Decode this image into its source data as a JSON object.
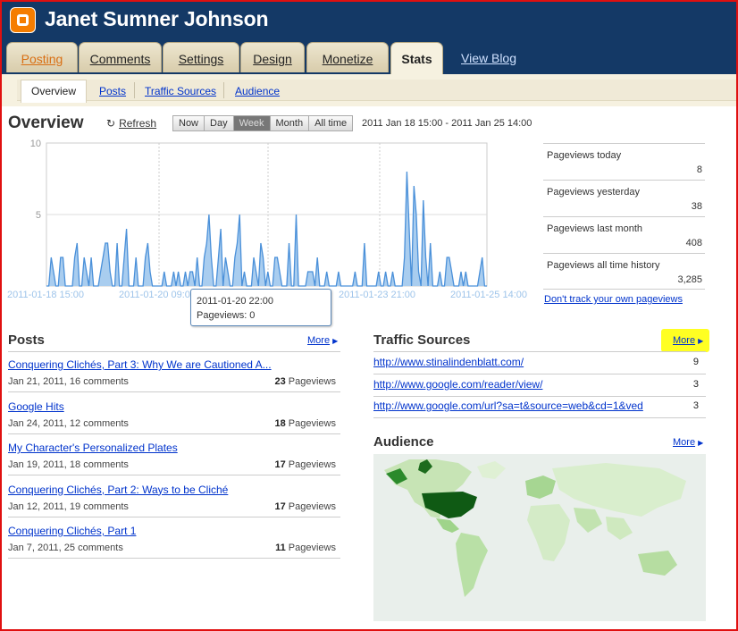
{
  "header": {
    "title": "Janet Sumner Johnson"
  },
  "tabs": [
    "Posting",
    "Comments",
    "Settings",
    "Design",
    "Monetize",
    "Stats"
  ],
  "view_blog": "View Blog",
  "subtabs": [
    "Overview",
    "Posts",
    "Traffic Sources",
    "Audience"
  ],
  "overview": {
    "title": "Overview",
    "refresh": "Refresh",
    "ranges": [
      "Now",
      "Day",
      "Week",
      "Month",
      "All time"
    ],
    "selected_range": "Week",
    "date_range": "2011 Jan 18 15:00 - 2011 Jan 25 14:00"
  },
  "chart_data": {
    "type": "area",
    "ylim": [
      0,
      10
    ],
    "yticks": [
      "10",
      "5"
    ],
    "xtick_labels": [
      "2011-01-18 15:00",
      "2011-01-20 09:00",
      "2011-01-23 21:00",
      "2011-01-25 14:00"
    ],
    "values": [
      0,
      0,
      2,
      1,
      0,
      0,
      2,
      2,
      0,
      0,
      0,
      0,
      2,
      3,
      0,
      0,
      2,
      1,
      0,
      2,
      0,
      0,
      0,
      1,
      2,
      3,
      3,
      1,
      0,
      0,
      3,
      0,
      0,
      2,
      4,
      0,
      0,
      0,
      2,
      0,
      0,
      0,
      2,
      3,
      1,
      0,
      0,
      0,
      0,
      0,
      1,
      0,
      0,
      0,
      1,
      0,
      1,
      0,
      0,
      1,
      0,
      1,
      1,
      0,
      2,
      0,
      0,
      2,
      3,
      5,
      2,
      0,
      0,
      2,
      4,
      0,
      2,
      1,
      0,
      0,
      2,
      3,
      5,
      0,
      1,
      0,
      0,
      0,
      2,
      1,
      0,
      3,
      2,
      0,
      1,
      0,
      0,
      2,
      2,
      1,
      0,
      0,
      0,
      3,
      0,
      0,
      5,
      0,
      0,
      0,
      0,
      1,
      1,
      1,
      0,
      2,
      0,
      0,
      0,
      1,
      0,
      0,
      0,
      0,
      1,
      0,
      0,
      0,
      0,
      0,
      0,
      1,
      0,
      0,
      0,
      3,
      0,
      0,
      0,
      0,
      0,
      1,
      0,
      0,
      1,
      0,
      0,
      1,
      0,
      0,
      0,
      0,
      2,
      8,
      4,
      0,
      7,
      5,
      1,
      0,
      6,
      2,
      0,
      3,
      0,
      0,
      0,
      1,
      0,
      0,
      2,
      2,
      1,
      0,
      0,
      0,
      1,
      0,
      1,
      0,
      0,
      0,
      0,
      0,
      1,
      2,
      0,
      0
    ],
    "tooltip": {
      "label": "2011-01-20 22:00",
      "value": "Pageviews: 0"
    }
  },
  "pageview_stats": [
    {
      "label": "Pageviews today",
      "value": "8"
    },
    {
      "label": "Pageviews yesterday",
      "value": "38"
    },
    {
      "label": "Pageviews last month",
      "value": "408"
    },
    {
      "label": "Pageviews all time history",
      "value": "3,285"
    }
  ],
  "dont_track": "Don't track your own pageviews",
  "posts": {
    "title": "Posts",
    "more": "More",
    "unit": "Pageviews",
    "items": [
      {
        "title": "Conquering Clichés, Part 3: Why We are Cautioned A...",
        "meta": "Jan 21, 2011, 16 comments",
        "views": "23"
      },
      {
        "title": "Google Hits",
        "meta": "Jan 24, 2011, 12 comments",
        "views": "18"
      },
      {
        "title": "My Character's Personalized Plates",
        "meta": "Jan 19, 2011, 18 comments",
        "views": "17"
      },
      {
        "title": "Conquering Clichés, Part 2: Ways to be Cliché",
        "meta": "Jan 12, 2011, 19 comments",
        "views": "17"
      },
      {
        "title": "Conquering Clichés, Part 1",
        "meta": "Jan 7, 2011, 25 comments",
        "views": "11"
      }
    ]
  },
  "traffic": {
    "title": "Traffic Sources",
    "more": "More",
    "items": [
      {
        "url": "http://www.stinalindenblatt.com/",
        "count": "9"
      },
      {
        "url": "http://www.google.com/reader/view/",
        "count": "3"
      },
      {
        "url": "http://www.google.com/url?sa=t&source=web&cd=1&ved",
        "count": "3"
      }
    ]
  },
  "audience": {
    "title": "Audience",
    "more": "More"
  },
  "colors": {
    "header": "#143966",
    "accent": "#f57d00",
    "chart_line": "#4a90d9",
    "chart_fill": "#a9cdef",
    "highlight": "#ffff22"
  }
}
